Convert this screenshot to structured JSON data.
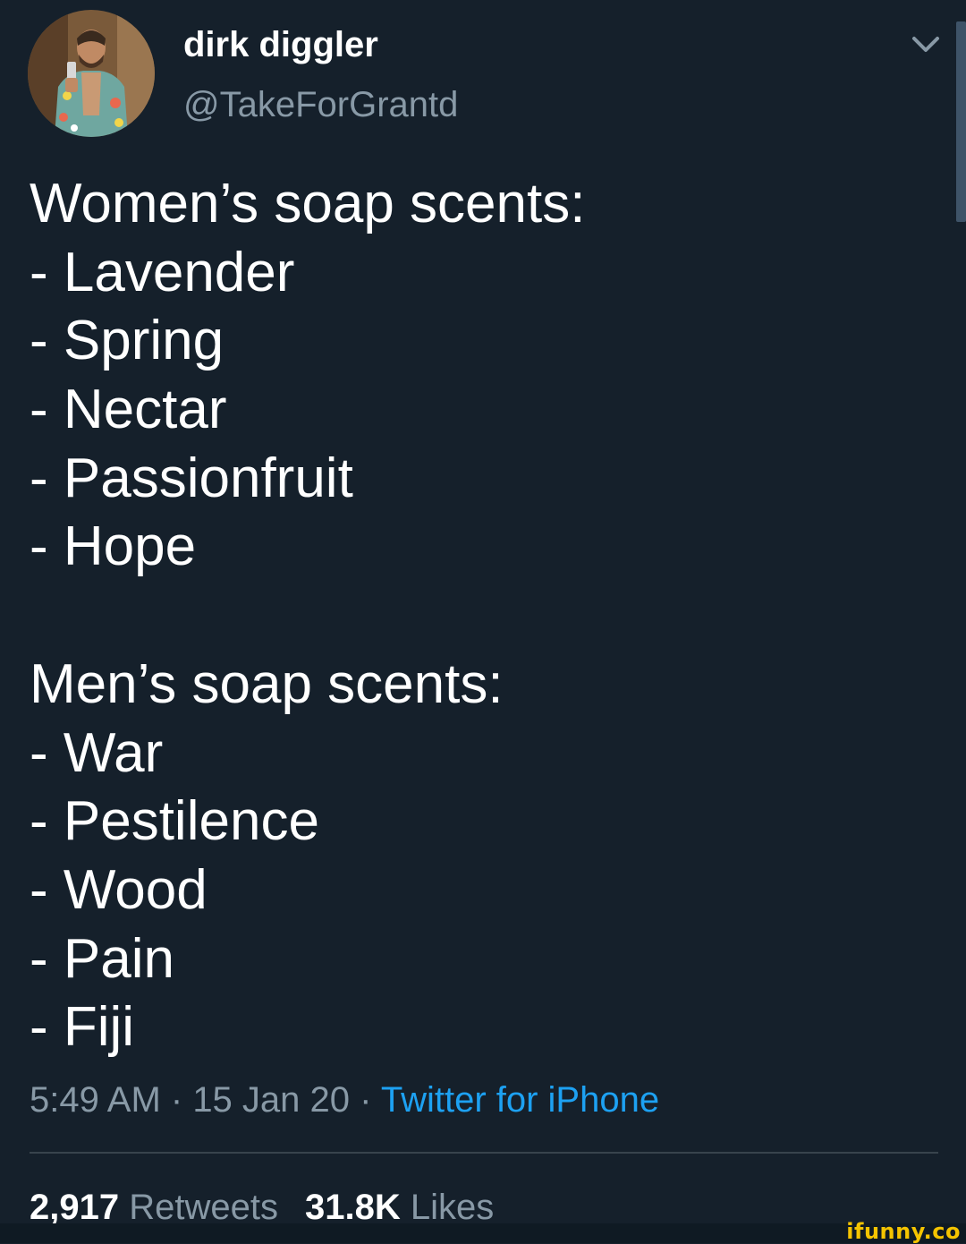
{
  "tweet": {
    "author": {
      "display_name": "dirk diggler",
      "handle": "@TakeForGrantd",
      "avatar_icon": "profile-photo"
    },
    "menu_icon": "chevron-down-icon",
    "text_lines": [
      "Women’s soap scents:",
      "- Lavender",
      "- Spring",
      "- Nectar",
      "- Passionfruit",
      "- Hope",
      "",
      "Men’s soap scents:",
      "- War",
      "- Pestilence",
      "- Wood",
      "- Pain",
      "- Fiji"
    ],
    "time": "5:49 AM",
    "separator": " · ",
    "date": "15 Jan 20",
    "source": "Twitter for iPhone",
    "stats": {
      "retweets_count": "2,917",
      "retweets_label": "Retweets",
      "likes_count": "31.8K",
      "likes_label": "Likes"
    }
  },
  "watermark": "ifunny.co",
  "colors": {
    "background": "#15202b",
    "text": "#ffffff",
    "secondary_text": "#8899a6",
    "link": "#1da1f2",
    "divider": "#38444d",
    "watermark": "#f5c400"
  }
}
